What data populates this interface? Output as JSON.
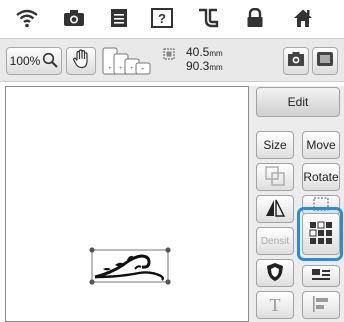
{
  "toolbar": {
    "zoom_label": "100%",
    "width_value": "40.5",
    "height_value": "90.3",
    "unit": "mm"
  },
  "panel": {
    "edit_label": "Edit",
    "size_label": "Size",
    "move_label": "Move",
    "rotate_label": "Rotate",
    "density_label": "Densit",
    "text_label": "T"
  },
  "icons": {
    "top": [
      "wifi-icon",
      "camera-icon",
      "document-icon",
      "help-icon",
      "embroidery-icon",
      "lock-icon",
      "home-icon"
    ]
  },
  "colors": {
    "highlight": "#1f8fe6",
    "icon": "#333333"
  }
}
